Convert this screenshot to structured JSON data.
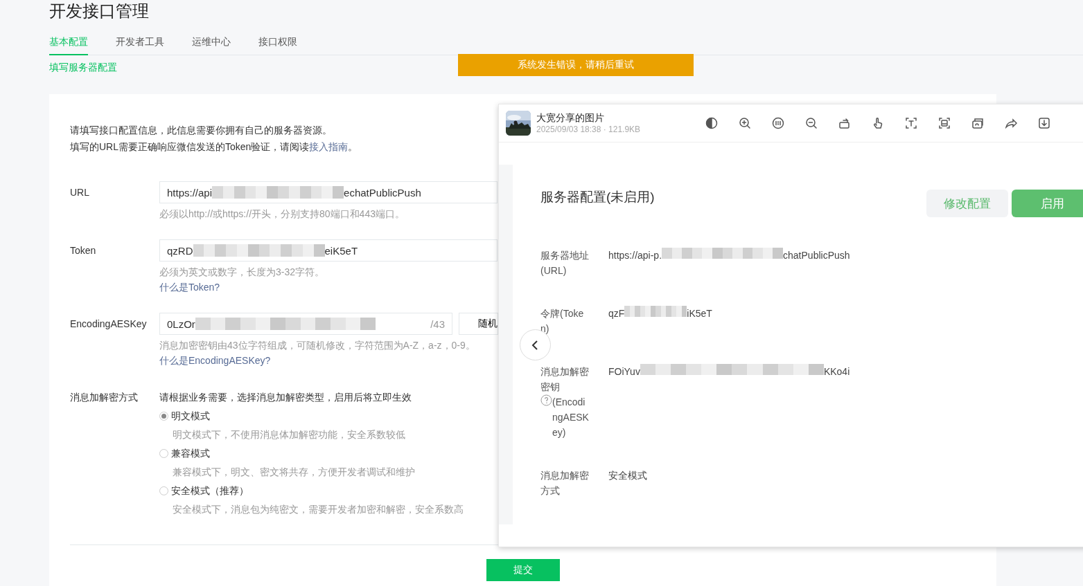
{
  "page": {
    "title": "开发接口管理",
    "tabs": [
      {
        "label": "基本配置",
        "selected": true
      },
      {
        "label": "开发者工具",
        "selected": false
      },
      {
        "label": "运维中心",
        "selected": false
      },
      {
        "label": "接口权限",
        "selected": false
      }
    ],
    "subtitle": "填写服务器配置",
    "toast": "系统发生错误，请稍后重试",
    "intro": [
      "请填写接口配置信息，此信息需要你拥有自己的服务器资源。",
      {
        "before": "填写的URL需要正确响应微信发送的Token验证，请阅读",
        "link": "接入指南",
        "after": "。"
      }
    ],
    "fields": [
      {
        "label": "URL",
        "value_parts": [
          "https://api",
          "echatPublicPush"
        ],
        "hint": "必须以http://或https://开头，分别支持80端口和443端口。"
      },
      {
        "label": "Token",
        "value_parts": [
          "qzRD",
          "eiK5eT"
        ],
        "hint": "必须为英文或数字，长度为3-32字符。",
        "link": "什么是Token?"
      },
      {
        "label": "EncodingAESKey",
        "value_parts": [
          "0LzOr"
        ],
        "counter": "/43",
        "button": "随机",
        "hint": "消息加密密钥由43位字符组成，可随机修改，字符范围为A-Z，a-z，0-9。",
        "link": "什么是EncodingAESKey?"
      }
    ],
    "mode": {
      "label": "消息加解密方式",
      "prompt": "请根据业务需要，选择消息加解密类型，启用后将立即生效",
      "options": [
        {
          "label": "明文模式",
          "hint": "明文模式下，不使用消息体加解密功能，安全系数较低",
          "selected": true
        },
        {
          "label": "兼容模式",
          "hint": "兼容模式下，明文、密文将共存，方便开发者调试和维护",
          "selected": false
        },
        {
          "label": "安全模式（推荐）",
          "hint": "安全模式下，消息包为纯密文，需要开发者加密和解密，安全系数高",
          "selected": false
        }
      ]
    },
    "submit": "提交"
  },
  "viewer": {
    "title": "大宽分享的图片",
    "meta": "2025/09/03 18:38 · 121.9KB",
    "toolbar": [
      {
        "kind": "contrast"
      },
      {
        "kind": "zoom-in"
      },
      {
        "kind": "actual-size"
      },
      {
        "kind": "zoom-out"
      },
      {
        "kind": "rotate"
      },
      {
        "kind": "hand"
      },
      {
        "kind": "text"
      },
      {
        "kind": "scan"
      },
      {
        "kind": "copy"
      },
      {
        "kind": "share"
      },
      {
        "kind": "download"
      }
    ],
    "image": {
      "heading": "服务器配置(未启用)",
      "buttons": [
        {
          "label": "修改配置",
          "kind": "secondary"
        },
        {
          "label": "启用",
          "kind": "primary"
        }
      ],
      "rows": [
        {
          "label": "服务器地址(URL)",
          "value_parts": [
            "https://api-p.",
            "chatPublicPush"
          ]
        },
        {
          "label": "令牌(Token)",
          "value_parts": [
            "qzF",
            "iK5eT"
          ]
        },
        {
          "label": "消息加解密密钥",
          "label_after": "(EncodingAESKey)",
          "help": true,
          "value_parts": [
            "FOiYuv",
            "KKo4i"
          ]
        },
        {
          "label": "消息加解密方式",
          "value_parts": [
            "安全模式"
          ]
        }
      ]
    }
  }
}
